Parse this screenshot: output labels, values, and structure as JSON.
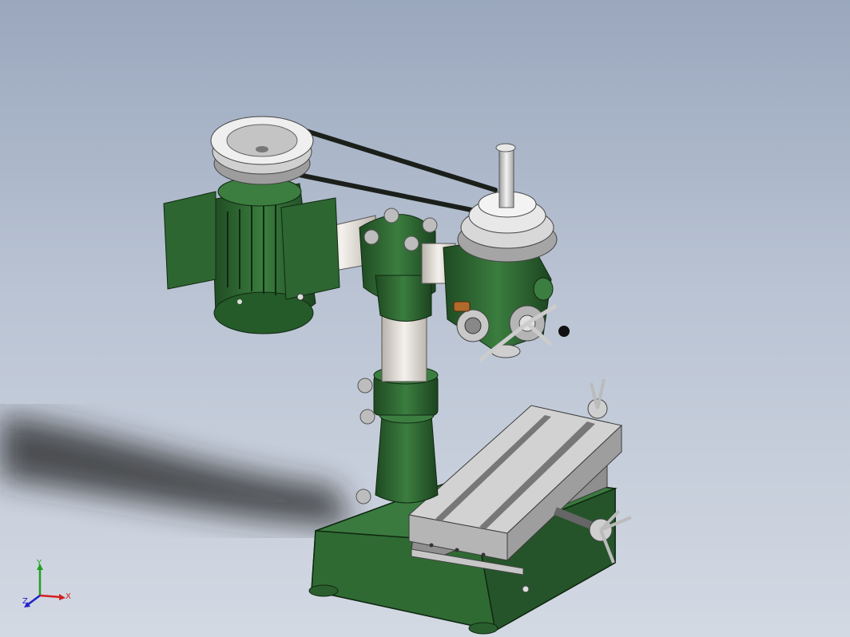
{
  "viewport": {
    "background_top": "#9aa7bd",
    "background_bottom": "#d3d9e3"
  },
  "model": {
    "subject": "radial-drilling-machine-assembly",
    "body_color": "#2f6a33",
    "body_dark": "#1f4722",
    "steel_color": "#cfcfcf",
    "column_color": "#e8e4df",
    "belt_color": "#1a1f1a"
  },
  "triad": {
    "x_label": "X",
    "y_label": "Y",
    "z_label": "Z",
    "x_color": "#d42020",
    "y_color": "#22a022",
    "z_color": "#2020c8"
  }
}
